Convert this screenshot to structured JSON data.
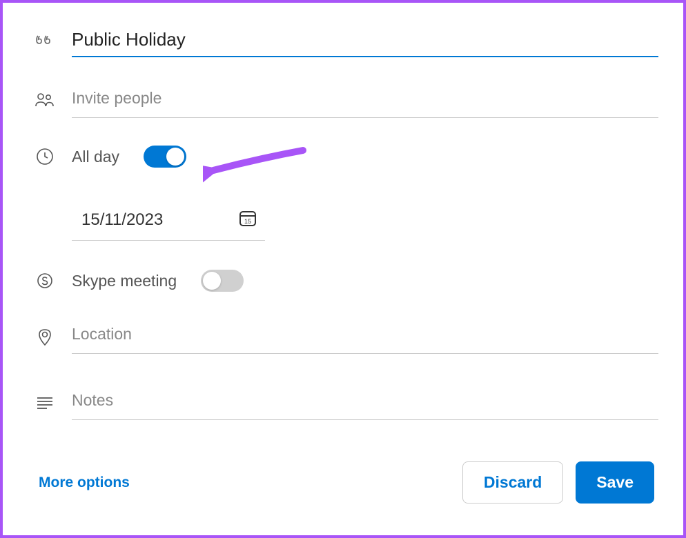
{
  "title": {
    "value": "Public Holiday"
  },
  "invite": {
    "placeholder": "Invite people"
  },
  "allday": {
    "label": "All day",
    "enabled": true
  },
  "date": {
    "value": "15/11/2023",
    "icon_day": "15"
  },
  "skype": {
    "label": "Skype meeting",
    "enabled": false
  },
  "location": {
    "placeholder": "Location"
  },
  "notes": {
    "placeholder": "Notes"
  },
  "footer": {
    "more_options": "More options",
    "discard": "Discard",
    "save": "Save"
  },
  "colors": {
    "accent": "#0078d4",
    "annotation": "#a855f7"
  }
}
